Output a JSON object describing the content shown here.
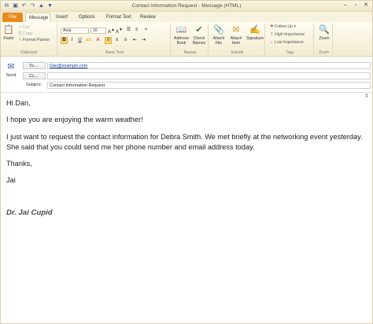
{
  "window": {
    "title": "Contact Information Request  -  Message (HTML)",
    "quick_access_icons": [
      "outlook-icon",
      "save-icon",
      "undo-icon",
      "redo-icon",
      "up-arrow-icon",
      "down-arrow-icon"
    ],
    "controls": {
      "minimize": "–",
      "maximize": "▫",
      "close": "✕"
    }
  },
  "tabs": [
    {
      "label": "File",
      "active": false
    },
    {
      "label": "Message",
      "active": true
    },
    {
      "label": "Insert",
      "active": false
    },
    {
      "label": "Options",
      "active": false
    },
    {
      "label": "Format Text",
      "active": false
    },
    {
      "label": "Review",
      "active": false
    }
  ],
  "ribbon": {
    "clipboard": {
      "label": "Clipboard",
      "paste": "Paste",
      "cut": "Cut",
      "copy": "Copy",
      "format_painter": "Format Painter"
    },
    "basic_text": {
      "label": "Basic Text",
      "font": "Arial",
      "size": "16",
      "bold": "B",
      "italic": "I",
      "underline": "U"
    },
    "names": {
      "label": "Names",
      "address_book": "Address Book",
      "check_names": "Check Names"
    },
    "include": {
      "label": "Include",
      "attach_file": "Attach File",
      "attach_item": "Attach Item",
      "signature": "Signature"
    },
    "tags": {
      "label": "Tags",
      "follow_up": "Follow Up",
      "high_importance": "High Importance",
      "low_importance": "Low Importance"
    },
    "zoom": {
      "label": "Zoom",
      "zoom": "Zoom"
    },
    "colors": {
      "file_tab": "#e68a1e",
      "highlight": "#f5d87a"
    }
  },
  "header": {
    "send": "Send",
    "to_label": "To...",
    "to_value": "Dan@example.com",
    "cc_label": "Cc...",
    "cc_value": "",
    "subject_label": "Subject:",
    "subject_value": "Contact Information Request"
  },
  "body": {
    "greeting": "Hi Dan,",
    "p1": "I hope you are enjoying the warm weather!",
    "p2": "I just want to request the contact information for Debra Smith.  We met briefly at the networking event yesterday.  She said that you could send me her phone number and email address today.",
    "closing": "Thanks,",
    "name": "Jai",
    "signature": "Dr. Jai Cupid"
  }
}
